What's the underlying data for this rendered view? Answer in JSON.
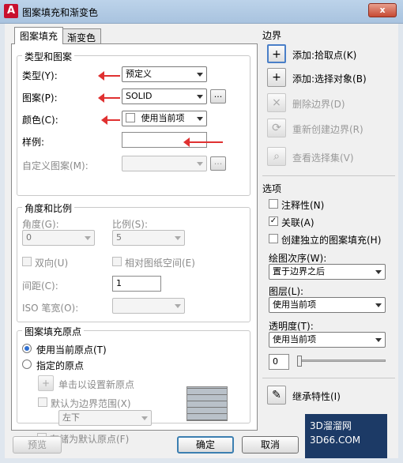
{
  "window": {
    "title": "图案填充和渐变色",
    "close_label": "x"
  },
  "tabs": [
    "图案填充",
    "渐变色"
  ],
  "type_pattern": {
    "title": "类型和图案",
    "type_label": "类型(Y):",
    "type_value": "预定义",
    "pattern_label": "图案(P):",
    "pattern_value": "SOLID",
    "color_label": "颜色(C):",
    "color_value": "使用当前项",
    "swatch_label": "样例:",
    "custom_label": "自定义图案(M):"
  },
  "angle_scale": {
    "title": "角度和比例",
    "angle_label": "角度(G):",
    "angle_value": "0",
    "scale_label": "比例(S):",
    "scale_value": "5",
    "double_label": "双向(U)",
    "paper_label": "相对图纸空间(E)",
    "spacing_label": "间距(C):",
    "spacing_value": "1",
    "iso_label": "ISO 笔宽(O):"
  },
  "origin": {
    "title": "图案填充原点",
    "current_label": "使用当前原点(T)",
    "specified_label": "指定的原点",
    "click_label": "单击以设置新原点",
    "default_extents_label": "默认为边界范围(X)",
    "default_extents_value": "左下",
    "store_label": "存储为默认原点(F)"
  },
  "boundaries": {
    "title": "边界",
    "items": [
      {
        "label": "添加:拾取点(K)"
      },
      {
        "label": "添加:选择对象(B)"
      },
      {
        "label": "删除边界(D)"
      },
      {
        "label": "重新创建边界(R)"
      },
      {
        "label": "查看选择集(V)"
      }
    ]
  },
  "options": {
    "title": "选项",
    "annotative_label": "注释性(N)",
    "associative_label": "关联(A)",
    "separate_label": "创建独立的图案填充(H)",
    "draw_order_label": "绘图次序(W):",
    "draw_order_value": "置于边界之后",
    "layer_label": "图层(L):",
    "layer_value": "使用当前项",
    "transparency_label": "透明度(T):",
    "transparency_value": "使用当前项",
    "transparency_number": "0"
  },
  "inherit_label": "继承特性(I)",
  "buttons": {
    "preview": "预览",
    "ok": "确定",
    "cancel": "取消"
  },
  "watermark": {
    "line1": "3D溜溜网",
    "line2": "3D66.COM"
  }
}
